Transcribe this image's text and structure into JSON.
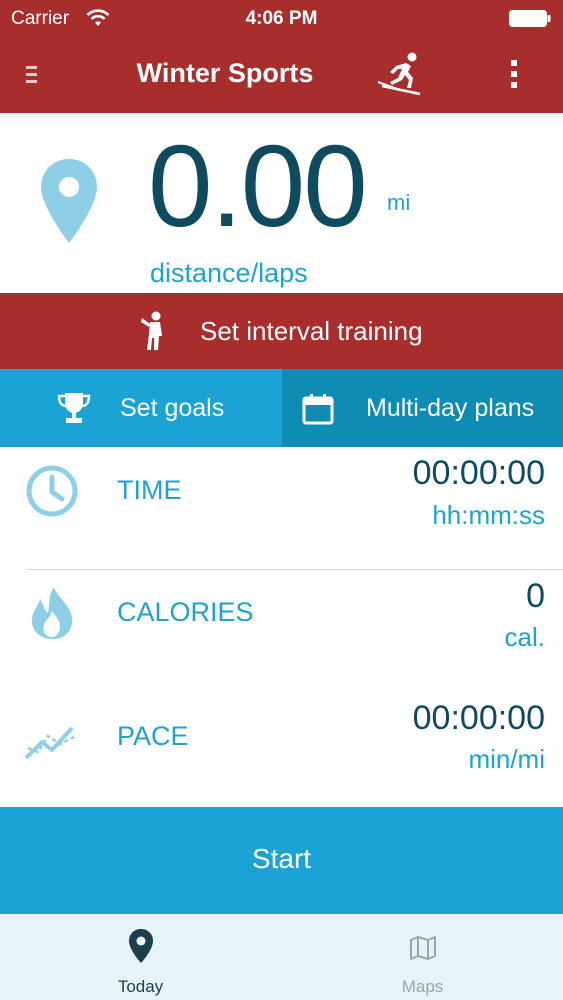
{
  "status_bar": {
    "carrier": "Carrier",
    "time": "4:06 PM",
    "icons": [
      "wifi-icon",
      "battery-icon"
    ]
  },
  "header": {
    "title": "Winter Sports",
    "icons": [
      "menu-icon",
      "skier-icon",
      "more-options-icon"
    ]
  },
  "distance": {
    "value": "0.00",
    "unit": "mi",
    "label": "distance/laps",
    "icon": "location-pin-icon"
  },
  "interval": {
    "label": "Set interval training",
    "icon": "whistle-coach-icon"
  },
  "actions": {
    "goals_label": "Set goals",
    "goals_icon": "trophy-icon",
    "plans_label": "Multi-day plans",
    "plans_icon": "calendar-icon"
  },
  "stats": {
    "time": {
      "label": "TIME",
      "value": "00:00:00",
      "unit": "hh:mm:ss",
      "icon": "clock-icon"
    },
    "calories": {
      "label": "CALORIES",
      "value": "0",
      "unit": "cal.",
      "icon": "flame-icon"
    },
    "pace": {
      "label": "PACE",
      "value": "00:00:00",
      "unit": "min/mi",
      "icon": "trend-chart-icon"
    }
  },
  "start_label": "Start",
  "tabs": [
    {
      "label": "Today",
      "icon": "location-pin-icon",
      "active": true
    },
    {
      "label": "Maps",
      "icon": "map-icon",
      "active": false
    }
  ],
  "colors": {
    "header_red": "#a82d2d",
    "accent_blue": "#1aa3d4",
    "dark_blue": "#0f8cb3",
    "value_navy": "#0f4a5f",
    "label_cyan": "#1ea3cf",
    "tab_bar_bg": "#e8f3f8"
  }
}
